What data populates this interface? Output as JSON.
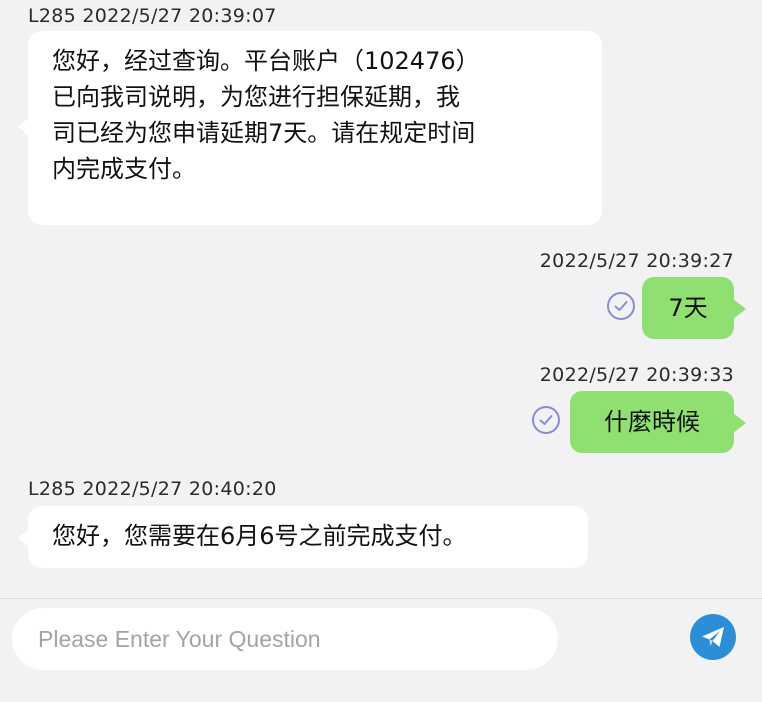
{
  "messages": [
    {
      "sender": "L285",
      "timestamp": "2022/5/27 20:39:07",
      "lines": [
        "您好，经过查询。平台账户（102476）",
        "已向我司说明，为您进行担保延期，我",
        "司已经为您申请延期7天。请在规定时间",
        "内完成支付。"
      ]
    },
    {
      "timestamp": "2022/5/27 20:39:27",
      "text": "7天"
    },
    {
      "timestamp": "2022/5/27 20:39:33",
      "text": "什麼時候"
    },
    {
      "sender": "L285",
      "timestamp": "2022/5/27 20:40:20",
      "text": "您好，您需要在6月6号之前完成支付。"
    }
  ],
  "composer": {
    "placeholder": "Please Enter Your Question"
  },
  "icons": {
    "read_status": "check-circle-icon",
    "send": "send-icon"
  },
  "colors": {
    "outgoing_bubble": "#8fe070",
    "send_button": "#2c8ed6",
    "check": "#8a8bd6"
  }
}
